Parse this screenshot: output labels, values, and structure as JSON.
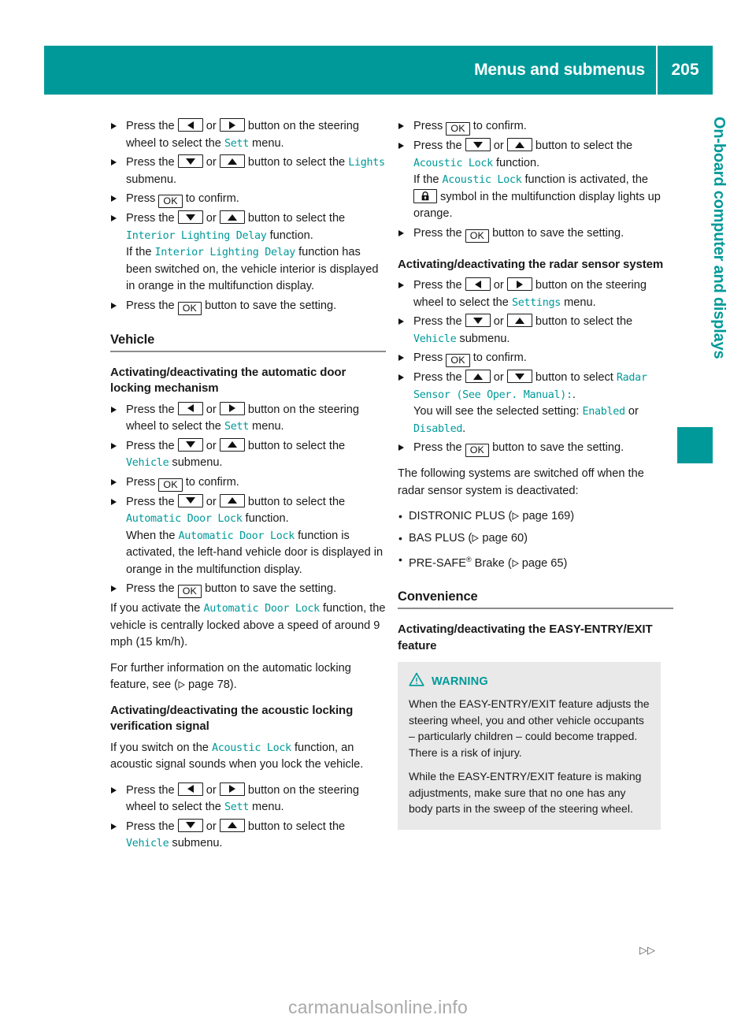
{
  "header": {
    "title": "Menus and submenus",
    "page_number": "205"
  },
  "side_tab": {
    "label": "On-board computer and displays"
  },
  "colors": {
    "accent_teal": "#009999",
    "warning_box_bg": "#e9e9e9",
    "rule_gray": "#8c8c8c",
    "watermark_gray": "#a9a9a9"
  },
  "keys": {
    "left": "left-arrow-key",
    "right": "right-arrow-key",
    "up": "up-arrow-key",
    "down": "down-arrow-key",
    "ok": "OK",
    "lock": "padlock-symbol"
  },
  "left_column": {
    "steps_lighting": [
      {
        "parts": [
          {
            "t": "Press the "
          },
          {
            "key": "left"
          },
          {
            "t": " or "
          },
          {
            "key": "right"
          },
          {
            "t": " button on the steering wheel to select the "
          },
          {
            "mono": "Sett"
          },
          {
            "t": " menu."
          }
        ]
      },
      {
        "parts": [
          {
            "t": "Press the "
          },
          {
            "key": "down"
          },
          {
            "t": " or "
          },
          {
            "key": "up"
          },
          {
            "t": " button to select the "
          },
          {
            "mono": "Lights"
          },
          {
            "t": " submenu."
          }
        ]
      },
      {
        "parts": [
          {
            "t": "Press "
          },
          {
            "key": "ok"
          },
          {
            "t": " to confirm."
          }
        ]
      },
      {
        "parts": [
          {
            "t": "Press the "
          },
          {
            "key": "down"
          },
          {
            "t": " or "
          },
          {
            "key": "up"
          },
          {
            "t": " button to select the "
          },
          {
            "mono": "Interior Lighting Delay"
          },
          {
            "t": " function."
          },
          {
            "br": true
          },
          {
            "t": "If the "
          },
          {
            "mono": "Interior Lighting Delay"
          },
          {
            "t": " function has been switched on, the vehicle interior is displayed in orange in the multifunction display."
          }
        ]
      },
      {
        "parts": [
          {
            "t": "Press the "
          },
          {
            "key": "ok"
          },
          {
            "t": " button to save the setting."
          }
        ]
      }
    ],
    "section_vehicle": {
      "heading": "Vehicle",
      "sub_heading_door_lock": "Activating/deactivating the automatic door locking mechanism",
      "steps_door_lock": [
        {
          "parts": [
            {
              "t": "Press the "
            },
            {
              "key": "left"
            },
            {
              "t": " or "
            },
            {
              "key": "right"
            },
            {
              "t": " button on the steering wheel to select the "
            },
            {
              "mono": "Sett"
            },
            {
              "t": " menu."
            }
          ]
        },
        {
          "parts": [
            {
              "t": "Press the "
            },
            {
              "key": "down"
            },
            {
              "t": " or "
            },
            {
              "key": "up"
            },
            {
              "t": " button to select the "
            },
            {
              "mono": "Vehicle"
            },
            {
              "t": " submenu."
            }
          ]
        },
        {
          "parts": [
            {
              "t": "Press "
            },
            {
              "key": "ok"
            },
            {
              "t": " to confirm."
            }
          ]
        },
        {
          "parts": [
            {
              "t": "Press the "
            },
            {
              "key": "down"
            },
            {
              "t": " or "
            },
            {
              "key": "up"
            },
            {
              "t": " button to select the "
            },
            {
              "mono": "Automatic Door Lock"
            },
            {
              "t": " function."
            },
            {
              "br": true
            },
            {
              "t": "When the "
            },
            {
              "mono": "Automatic Door Lock"
            },
            {
              "t": " function is activated, the left-hand vehicle door is displayed in orange in the multifunction display."
            }
          ]
        },
        {
          "parts": [
            {
              "t": "Press the "
            },
            {
              "key": "ok"
            },
            {
              "t": " button to save the setting."
            }
          ]
        }
      ],
      "para_activate": [
        {
          "t": "If you activate the "
        },
        {
          "mono": "Automatic Door Lock"
        },
        {
          "t": " function, the vehicle is centrally locked above a speed of around 9 mph (15 km/h)."
        }
      ],
      "para_further_info": [
        {
          "t": "For further information on the automatic locking feature, see ("
        },
        {
          "ref": true
        },
        {
          "t": " page 78)."
        }
      ],
      "sub_heading_acoustic": "Activating/deactivating the acoustic locking verification signal",
      "para_acoustic": [
        {
          "t": "If you switch on the "
        },
        {
          "mono": "Acoustic Lock"
        },
        {
          "t": " function, an acoustic signal sounds when you lock the vehicle."
        }
      ],
      "steps_acoustic": [
        {
          "parts": [
            {
              "t": "Press the "
            },
            {
              "key": "left"
            },
            {
              "t": " or "
            },
            {
              "key": "right"
            },
            {
              "t": " button on the steering wheel to select the "
            },
            {
              "mono": "Sett"
            },
            {
              "t": " menu."
            }
          ]
        },
        {
          "parts": [
            {
              "t": "Press the "
            },
            {
              "key": "down"
            },
            {
              "t": " or "
            },
            {
              "key": "up"
            },
            {
              "t": " button to select the "
            },
            {
              "mono": "Vehicle"
            },
            {
              "t": " submenu."
            }
          ]
        }
      ]
    }
  },
  "right_column": {
    "steps_acoustic_cont": [
      {
        "parts": [
          {
            "t": "Press "
          },
          {
            "key": "ok"
          },
          {
            "t": " to confirm."
          }
        ]
      },
      {
        "parts": [
          {
            "t": "Press the "
          },
          {
            "key": "down"
          },
          {
            "t": " or "
          },
          {
            "key": "up"
          },
          {
            "t": " button to select the "
          },
          {
            "mono": "Acoustic Lock"
          },
          {
            "t": " function."
          },
          {
            "br": true
          },
          {
            "t": "If the "
          },
          {
            "mono": "Acoustic Lock"
          },
          {
            "t": " function is activated, the "
          },
          {
            "key": "lock"
          },
          {
            "t": " symbol in the multifunction display lights up orange."
          }
        ]
      },
      {
        "parts": [
          {
            "t": "Press the "
          },
          {
            "key": "ok"
          },
          {
            "t": " button to save the setting."
          }
        ]
      }
    ],
    "sub_heading_radar": "Activating/deactivating the radar sensor system",
    "steps_radar": [
      {
        "parts": [
          {
            "t": "Press the "
          },
          {
            "key": "left"
          },
          {
            "t": " or "
          },
          {
            "key": "right"
          },
          {
            "t": " button on the steering wheel to select the "
          },
          {
            "mono": "Settings"
          },
          {
            "t": " menu."
          }
        ]
      },
      {
        "parts": [
          {
            "t": "Press the "
          },
          {
            "key": "down"
          },
          {
            "t": " or "
          },
          {
            "key": "up"
          },
          {
            "t": " button to select the "
          },
          {
            "mono": "Vehicle"
          },
          {
            "t": " submenu."
          }
        ]
      },
      {
        "parts": [
          {
            "t": "Press "
          },
          {
            "key": "ok"
          },
          {
            "t": " to confirm."
          }
        ]
      },
      {
        "parts": [
          {
            "t": "Press the "
          },
          {
            "key": "up"
          },
          {
            "t": " or "
          },
          {
            "key": "down"
          },
          {
            "t": " button to select "
          },
          {
            "mono": "Radar Sensor (See Oper. Manual):"
          },
          {
            "t": "."
          },
          {
            "br": true
          },
          {
            "t": "You will see the selected setting: "
          },
          {
            "mono": "Enabled"
          },
          {
            "t": " or "
          },
          {
            "mono": "Disabled"
          },
          {
            "t": "."
          }
        ]
      },
      {
        "parts": [
          {
            "t": "Press the "
          },
          {
            "key": "ok"
          },
          {
            "t": " button to save the setting."
          }
        ]
      }
    ],
    "para_switched_off": "The following systems are switched off when the radar sensor system is deactivated:",
    "systems_list": [
      {
        "name": "DISTRONIC PLUS",
        "page": "169"
      },
      {
        "name": "BAS PLUS",
        "page": "60"
      },
      {
        "name": "PRE-SAFE",
        "superscript": "®",
        "suffix": " Brake",
        "page": "65"
      }
    ],
    "section_convenience": {
      "heading": "Convenience",
      "sub_heading_easy": "Activating/deactivating the EASY-ENTRY/EXIT feature",
      "warning": {
        "title": "WARNING",
        "icon": "warning-triangle-icon",
        "paragraphs": [
          "When the EASY-ENTRY/EXIT feature adjusts the steering wheel, you and other vehicle occupants – particularly children – could become trapped. There is a risk of injury.",
          "While the EASY-ENTRY/EXIT feature is making adjustments, make sure that no one has any body parts in the sweep of the steering wheel."
        ]
      }
    }
  },
  "footer": {
    "continuation_marker": "▷▷",
    "watermark": "carmanualsonline.info"
  }
}
